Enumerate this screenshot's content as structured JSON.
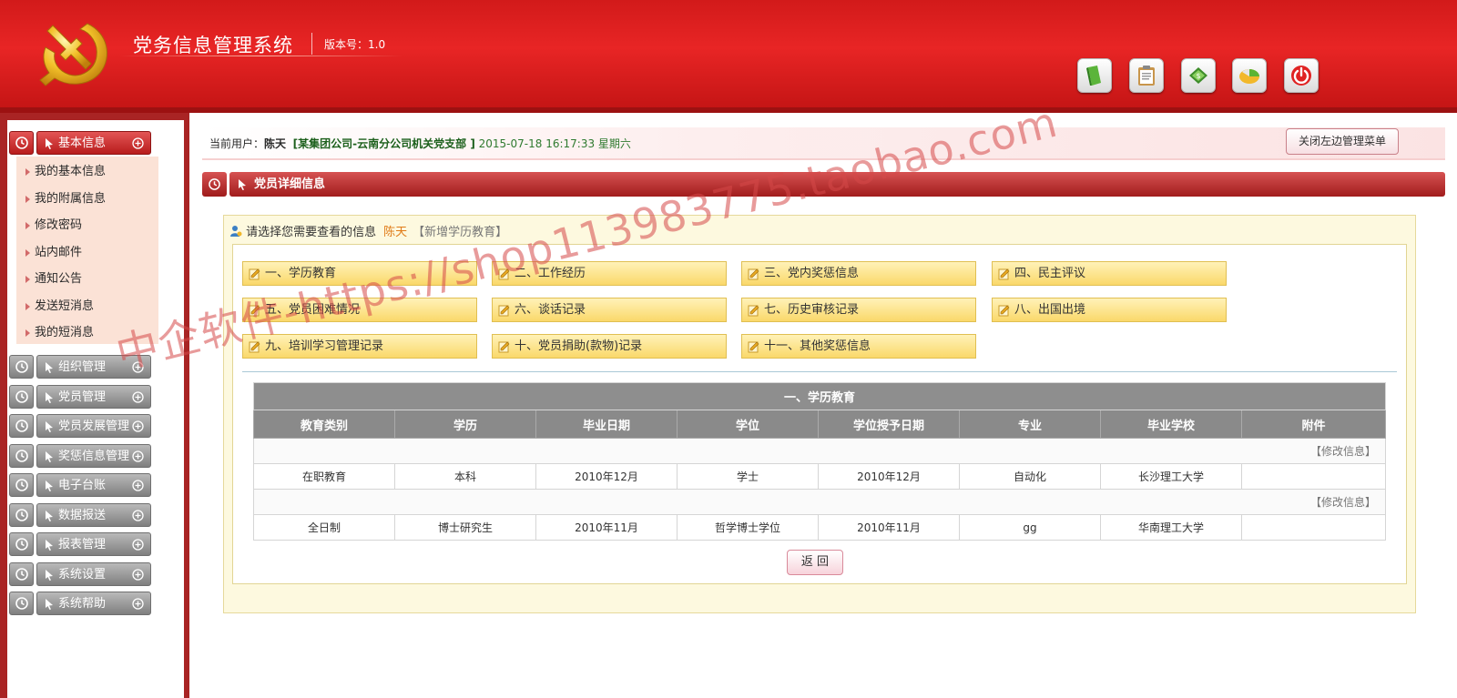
{
  "header": {
    "title": "党务信息管理系统",
    "version": "版本号：1.0",
    "tools": [
      "book-icon",
      "clipboard-icon",
      "money-icon",
      "chart-icon",
      "power-icon"
    ]
  },
  "sidebar": {
    "active_menu": "基本信息",
    "sub_items": [
      "我的基本信息",
      "我的附属信息",
      "修改密码",
      "站内邮件",
      "通知公告",
      "发送短消息",
      "我的短消息"
    ],
    "menus": [
      "组织管理",
      "党员管理",
      "党员发展管理",
      "奖惩信息管理",
      "电子台账",
      "数据报送",
      "报表管理",
      "系统设置",
      "系统帮助"
    ]
  },
  "userbar": {
    "label": "当前用户：",
    "user": "陈天",
    "org": "[某集团公司-云南分公司机关党支部 ]",
    "time": "2015-07-18 16:17:33 星期六",
    "close_button": "关闭左边管理菜单"
  },
  "section": {
    "title": "党员详细信息"
  },
  "prompt": {
    "text": "请选择您需要查看的信息",
    "name": "陈天",
    "add": "【新增学历教育】"
  },
  "categories": [
    "一、学历教育",
    "二、工作经历",
    "三、党内奖惩信息",
    "四、民主评议",
    "五、党员困难情况",
    "六、谈话记录",
    "七、历史审核记录",
    "八、出国出境",
    "九、培训学习管理记录",
    "十、党员捐助(款物)记录",
    "十一、其他奖惩信息"
  ],
  "table": {
    "caption": "一、学历教育",
    "headers": [
      "教育类别",
      "学历",
      "毕业日期",
      "学位",
      "学位授予日期",
      "专业",
      "毕业学校",
      "附件"
    ],
    "edit_label": "【修改信息】",
    "rows": [
      [
        "在职教育",
        "本科",
        "2010年12月",
        "学士",
        "2010年12月",
        "自动化",
        "长沙理工大学",
        ""
      ],
      [
        "全日制",
        "博士研究生",
        "2010年11月",
        "哲学博士学位",
        "2010年11月",
        "gg",
        "华南理工大学",
        ""
      ]
    ]
  },
  "back_button": "返 回",
  "watermark": "中企软件-https://shop113983775.taobao.com",
  "colors": {
    "header_red": "#e82525",
    "accent_dark": "#a92424",
    "category_yellow": "#fad86a"
  }
}
